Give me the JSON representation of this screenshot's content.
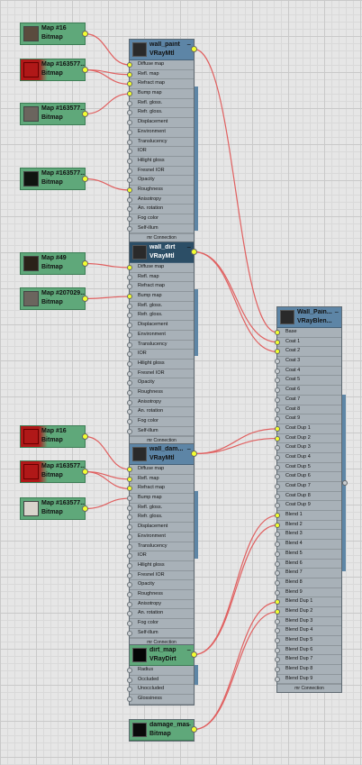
{
  "bitmaps": [
    {
      "id": "b1",
      "title": "Map #16",
      "type": "Bitmap",
      "thumb": "#5a4b3e",
      "red": false
    },
    {
      "id": "b2",
      "title": "Map #163577...",
      "type": "Bitmap",
      "thumb": "#b01818",
      "red": true
    },
    {
      "id": "b3",
      "title": "Map #163577...",
      "type": "Bitmap",
      "thumb": "#6b655e",
      "red": false
    },
    {
      "id": "b4",
      "title": "Map #163577...",
      "type": "Bitmap",
      "thumb": "#101410",
      "red": false
    },
    {
      "id": "b5",
      "title": "Map #49",
      "type": "Bitmap",
      "thumb": "#2a2219",
      "red": false
    },
    {
      "id": "b6",
      "title": "Map #207029...",
      "type": "Bitmap",
      "thumb": "#6b655e",
      "red": false
    },
    {
      "id": "b7",
      "title": "Map #16",
      "type": "Bitmap",
      "thumb": "#b01818",
      "red": true
    },
    {
      "id": "b8",
      "title": "Map #163577...",
      "type": "Bitmap",
      "thumb": "#b01818",
      "red": true
    },
    {
      "id": "b9",
      "title": "Map #163577...",
      "type": "Bitmap",
      "thumb": "#d9d4cc",
      "red": false
    }
  ],
  "vray_slots": [
    "Diffuse map",
    "Refl. map",
    "Refract map",
    "Bump map",
    "Refl. gloss.",
    "Refr. gloss.",
    "Displacement",
    "Environment",
    "Translucency",
    "IOR",
    "Hilight gloss",
    "Fresnel IOR",
    "Opacity",
    "Roughness",
    "Anisotropy",
    "An. rotation",
    "Fog color",
    "Self-illum"
  ],
  "materials": [
    {
      "id": "m1",
      "title": "wall_paint",
      "type": "VRayMtl",
      "footer": "mr Connection",
      "connected": [
        0,
        1,
        2,
        3,
        13
      ],
      "header_style": "blue",
      "minimize": "−"
    },
    {
      "id": "m2",
      "title": "wall_dirt",
      "type": "VRayMtl",
      "footer": "mr Connection",
      "connected": [
        0,
        3
      ],
      "header_style": "dark",
      "minimize": "−"
    },
    {
      "id": "m3",
      "title": "wall_dam...",
      "type": "VRayMtl",
      "footer": "mr Connection",
      "connected": [
        0,
        1,
        2
      ],
      "header_style": "blue",
      "minimize": "−"
    }
  ],
  "dirt": {
    "title": "dirt_map",
    "type": "VRayDirt",
    "slots": [
      "Radius",
      "Occluded",
      "Unoccluded",
      "Glossiness"
    ],
    "minimize": "−"
  },
  "mask": {
    "title": "damage_mask",
    "type": "Bitmap",
    "minimize": "−"
  },
  "blend": {
    "title": "Wall_Pain...",
    "type": "VRayBlen...",
    "footer": "mr Connection",
    "minimize": "−",
    "slots": [
      "Base",
      "Coat 1",
      "Coat 2",
      "Coat 3",
      "Coat 4",
      "Coat 5",
      "Coat 6",
      "Coat 7",
      "Coat 8",
      "Coat 9",
      "Coat Dup 1",
      "Coat Dup 2",
      "Coat Dup 3",
      "Coat Dup 4",
      "Coat Dup 5",
      "Coat Dup 6",
      "Coat Dup 7",
      "Coat Dup 8",
      "Coat Dup 9",
      "Blend 1",
      "Blend 2",
      "Blend 3",
      "Blend 4",
      "Blend 5",
      "Blend 6",
      "Blend 7",
      "Blend 8",
      "Blend 9",
      "Blend Dup 1",
      "Blend Dup 2",
      "Blend Dup 3",
      "Blend Dup 4",
      "Blend Dup 5",
      "Blend Dup 6",
      "Blend Dup 7",
      "Blend Dup 8",
      "Blend Dup 9"
    ],
    "connected": [
      0,
      1,
      2,
      10,
      11,
      19,
      20,
      28,
      29
    ]
  },
  "colors": {
    "wire": "#e06060",
    "socket_on": "#f2ff30",
    "bitmap_green": "#5fa87a",
    "material_header": "#5d85a6",
    "grid_bg": "#e6e6e6"
  }
}
